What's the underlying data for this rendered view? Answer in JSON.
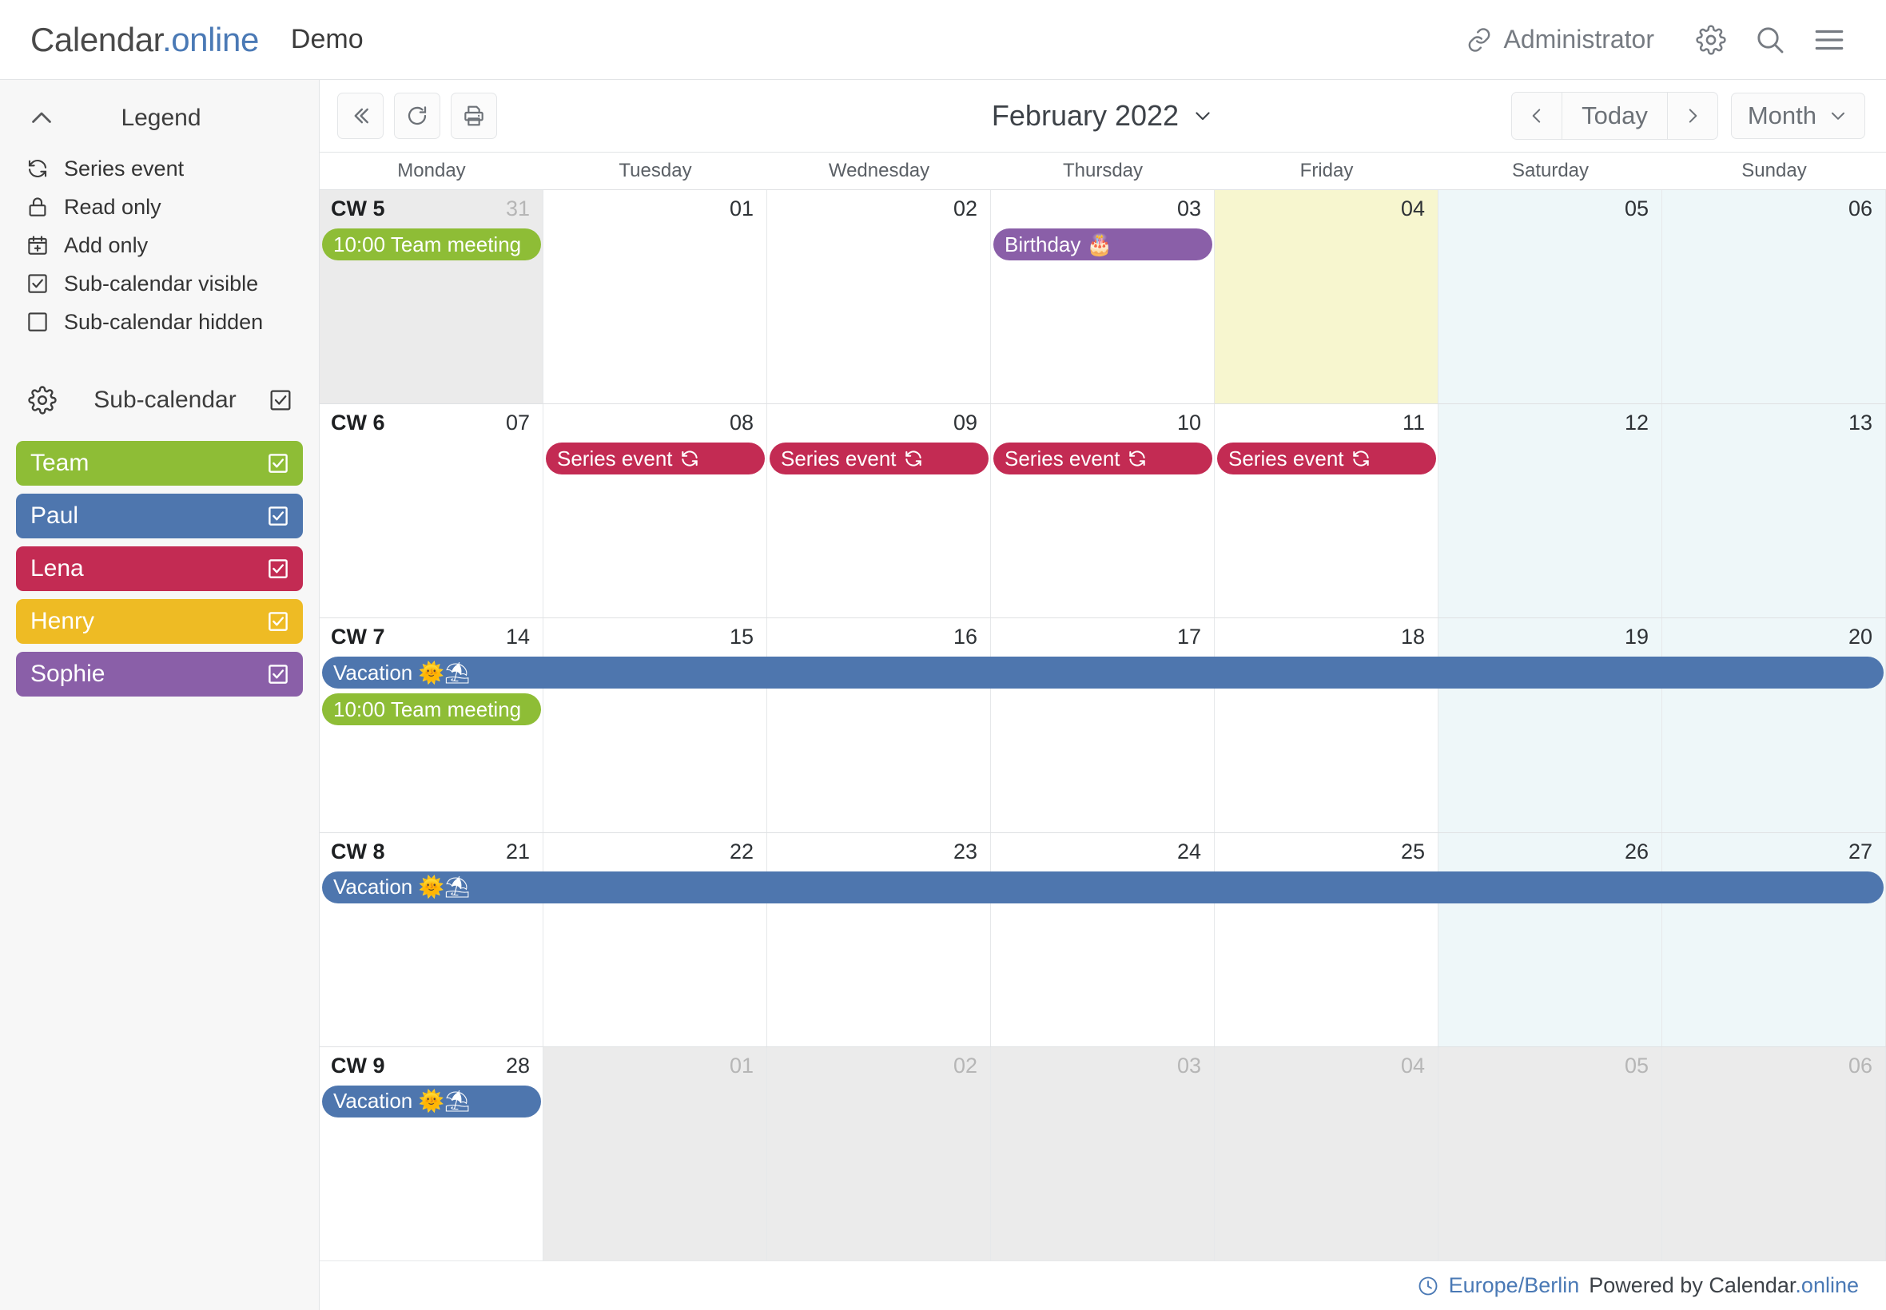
{
  "header": {
    "logo_main": "Calendar",
    "logo_suffix": ".online",
    "demo_title": "Demo",
    "admin_label": "Administrator",
    "icons": {
      "link": "link-icon",
      "gear": "gear-icon",
      "search": "search-icon",
      "menu": "hamburger-menu-icon"
    }
  },
  "sidebar": {
    "legend_title": "Legend",
    "legend_items": [
      {
        "icon": "series-refresh-icon",
        "label": "Series event"
      },
      {
        "icon": "lock-icon",
        "label": "Read only"
      },
      {
        "icon": "calendar-plus-icon",
        "label": "Add only"
      },
      {
        "icon": "checkbox-checked-icon",
        "label": "Sub-calendar visible"
      },
      {
        "icon": "checkbox-empty-icon",
        "label": "Sub-calendar hidden"
      }
    ],
    "subcal_title": "Sub-calendar",
    "subcal_all_checked": true,
    "calendars": [
      {
        "name": "Team",
        "color": "#8ebd36",
        "checked": true
      },
      {
        "name": "Paul",
        "color": "#4e76ae",
        "checked": true
      },
      {
        "name": "Lena",
        "color": "#c32b53",
        "checked": true
      },
      {
        "name": "Henry",
        "color": "#eebb24",
        "checked": true
      },
      {
        "name": "Sophie",
        "color": "#8a5fa8",
        "checked": true
      }
    ]
  },
  "toolbar": {
    "collapse_label": "«",
    "refresh_icon": "refresh-icon",
    "print_icon": "print-icon",
    "month_title": "February 2022",
    "prev_label": "‹",
    "today_label": "Today",
    "next_label": "›",
    "view_label": "Month"
  },
  "calendar": {
    "day_names": [
      "Monday",
      "Tuesday",
      "Wednesday",
      "Thursday",
      "Friday",
      "Saturday",
      "Sunday"
    ],
    "weeks": [
      {
        "cw": "CW 5",
        "days": [
          {
            "num": "31",
            "other": true,
            "weekend": false,
            "today": false
          },
          {
            "num": "01",
            "other": false,
            "weekend": false,
            "today": false
          },
          {
            "num": "02",
            "other": false,
            "weekend": false,
            "today": false
          },
          {
            "num": "03",
            "other": false,
            "weekend": false,
            "today": false
          },
          {
            "num": "04",
            "other": false,
            "weekend": false,
            "today": true
          },
          {
            "num": "05",
            "other": false,
            "weekend": true,
            "today": false
          },
          {
            "num": "06",
            "other": false,
            "weekend": true,
            "today": false
          }
        ],
        "events": [
          {
            "title": "10:00 Team meeting",
            "color": "#8ebd36",
            "start": 0,
            "span": 1,
            "row": 0,
            "icon": "",
            "round_left": true,
            "round_right": true
          },
          {
            "title": "Birthday 🎂",
            "color": "#8a5fa8",
            "start": 3,
            "span": 1,
            "row": 0,
            "icon": "",
            "round_left": true,
            "round_right": true
          }
        ]
      },
      {
        "cw": "CW 6",
        "days": [
          {
            "num": "07",
            "other": false,
            "weekend": false,
            "today": false
          },
          {
            "num": "08",
            "other": false,
            "weekend": false,
            "today": false
          },
          {
            "num": "09",
            "other": false,
            "weekend": false,
            "today": false
          },
          {
            "num": "10",
            "other": false,
            "weekend": false,
            "today": false
          },
          {
            "num": "11",
            "other": false,
            "weekend": false,
            "today": false
          },
          {
            "num": "12",
            "other": false,
            "weekend": true,
            "today": false
          },
          {
            "num": "13",
            "other": false,
            "weekend": true,
            "today": false
          }
        ],
        "events": [
          {
            "title": "Series event",
            "color": "#c32b53",
            "start": 1,
            "span": 1,
            "row": 0,
            "icon": "series-refresh-icon",
            "round_left": true,
            "round_right": true
          },
          {
            "title": "Series event",
            "color": "#c32b53",
            "start": 2,
            "span": 1,
            "row": 0,
            "icon": "series-refresh-icon",
            "round_left": true,
            "round_right": true
          },
          {
            "title": "Series event",
            "color": "#c32b53",
            "start": 3,
            "span": 1,
            "row": 0,
            "icon": "series-refresh-icon",
            "round_left": true,
            "round_right": true
          },
          {
            "title": "Series event",
            "color": "#c32b53",
            "start": 4,
            "span": 1,
            "row": 0,
            "icon": "series-refresh-icon",
            "round_left": true,
            "round_right": true
          }
        ]
      },
      {
        "cw": "CW 7",
        "days": [
          {
            "num": "14",
            "other": false,
            "weekend": false,
            "today": false
          },
          {
            "num": "15",
            "other": false,
            "weekend": false,
            "today": false
          },
          {
            "num": "16",
            "other": false,
            "weekend": false,
            "today": false
          },
          {
            "num": "17",
            "other": false,
            "weekend": false,
            "today": false
          },
          {
            "num": "18",
            "other": false,
            "weekend": false,
            "today": false
          },
          {
            "num": "19",
            "other": false,
            "weekend": true,
            "today": false
          },
          {
            "num": "20",
            "other": false,
            "weekend": true,
            "today": false
          }
        ],
        "events": [
          {
            "title": "Vacation 🌞⛱",
            "color": "#4e76ae",
            "start": 0,
            "span": 7,
            "row": 0,
            "icon": "",
            "round_left": true,
            "round_right": true
          },
          {
            "title": "10:00 Team meeting",
            "color": "#8ebd36",
            "start": 0,
            "span": 1,
            "row": 1,
            "icon": "",
            "round_left": true,
            "round_right": true
          }
        ]
      },
      {
        "cw": "CW 8",
        "days": [
          {
            "num": "21",
            "other": false,
            "weekend": false,
            "today": false
          },
          {
            "num": "22",
            "other": false,
            "weekend": false,
            "today": false
          },
          {
            "num": "23",
            "other": false,
            "weekend": false,
            "today": false
          },
          {
            "num": "24",
            "other": false,
            "weekend": false,
            "today": false
          },
          {
            "num": "25",
            "other": false,
            "weekend": false,
            "today": false
          },
          {
            "num": "26",
            "other": false,
            "weekend": true,
            "today": false
          },
          {
            "num": "27",
            "other": false,
            "weekend": true,
            "today": false
          }
        ],
        "events": [
          {
            "title": "Vacation 🌞⛱",
            "color": "#4e76ae",
            "start": 0,
            "span": 7,
            "row": 0,
            "icon": "",
            "round_left": true,
            "round_right": true
          }
        ]
      },
      {
        "cw": "CW 9",
        "days": [
          {
            "num": "28",
            "other": false,
            "weekend": false,
            "today": false
          },
          {
            "num": "01",
            "other": true,
            "weekend": false,
            "today": false
          },
          {
            "num": "02",
            "other": true,
            "weekend": false,
            "today": false
          },
          {
            "num": "03",
            "other": true,
            "weekend": false,
            "today": false
          },
          {
            "num": "04",
            "other": true,
            "weekend": false,
            "today": false
          },
          {
            "num": "05",
            "other": true,
            "weekend": true,
            "today": false
          },
          {
            "num": "06",
            "other": true,
            "weekend": true,
            "today": false
          }
        ],
        "events": [
          {
            "title": "Vacation 🌞⛱",
            "color": "#4e76ae",
            "start": 0,
            "span": 1,
            "row": 0,
            "icon": "",
            "round_left": true,
            "round_right": true
          }
        ]
      }
    ]
  },
  "footer": {
    "timezone": "Europe/Berlin",
    "powered_prefix": "Powered by ",
    "powered_brand": "Calendar",
    "powered_brand_suffix": ".online",
    "clock_icon": "clock-icon"
  }
}
